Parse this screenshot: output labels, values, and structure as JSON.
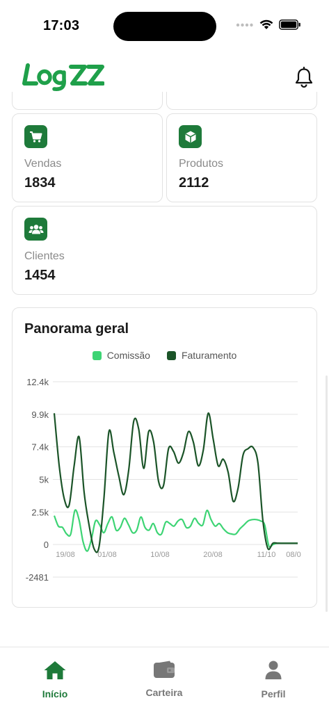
{
  "status_bar": {
    "time": "17:03"
  },
  "header": {
    "brand": "LOGZZ"
  },
  "stats": [
    {
      "label": "Vendas",
      "value": "1834",
      "icon": "cart-icon"
    },
    {
      "label": "Produtos",
      "value": "2112",
      "icon": "box-icon"
    },
    {
      "label": "Clientes",
      "value": "1454",
      "icon": "users-icon"
    }
  ],
  "chart": {
    "title": "Panorama geral"
  },
  "chart_data": {
    "type": "line",
    "yticks": [
      "12.4k",
      "9.9k",
      "7.4k",
      "5k",
      "2.5k",
      "0",
      "-2481"
    ],
    "ylim": [
      -2481,
      12400
    ],
    "xticks": [
      "19/08",
      "01/08",
      "10/08",
      "20/08",
      "11/10",
      "08/0"
    ],
    "x": [
      0,
      4,
      9,
      13,
      18,
      22,
      27,
      31,
      36,
      40,
      45,
      49,
      54,
      58,
      63,
      67,
      72,
      76,
      81,
      85,
      90,
      94,
      99,
      103,
      108,
      112,
      117,
      121,
      126,
      130,
      135,
      139,
      144,
      148,
      153,
      157,
      162,
      166,
      171,
      175,
      180,
      184,
      189,
      193,
      198,
      202,
      207,
      211,
      216,
      220,
      225,
      229,
      234,
      238,
      243,
      247,
      252,
      256,
      261,
      265,
      270,
      274,
      279,
      283,
      288,
      292,
      297,
      301,
      306,
      310,
      315,
      319,
      324,
      328,
      333,
      337,
      342,
      346,
      351
    ],
    "series": [
      {
        "name": "Comissão",
        "color": "#3dd474",
        "values": [
          2200,
          1400,
          1300,
          800,
          800,
          2600,
          1900,
          200,
          -500,
          400,
          1800,
          1500,
          900,
          1600,
          2100,
          1100,
          1300,
          2000,
          1500,
          900,
          1100,
          2100,
          1300,
          1100,
          1600,
          900,
          800,
          1700,
          1600,
          1400,
          1800,
          1900,
          1300,
          1400,
          2000,
          1600,
          1500,
          2600,
          1900,
          1400,
          1600,
          1200,
          900,
          800,
          800,
          1200,
          1500,
          1800,
          1900,
          1900,
          1800,
          1500,
          -100,
          0,
          100,
          100,
          100,
          100,
          100,
          100
        ]
      },
      {
        "name": "Faturamento",
        "color": "#1b5428",
        "values": [
          10000,
          6000,
          3500,
          3000,
          6000,
          8200,
          4000,
          1500,
          -300,
          -200,
          3500,
          8600,
          7000,
          5200,
          3800,
          5700,
          9400,
          8800,
          5800,
          8600,
          7800,
          4800,
          4500,
          7300,
          7100,
          6200,
          7000,
          8600,
          7800,
          6000,
          7200,
          10000,
          8000,
          6000,
          6500,
          5500,
          3300,
          4300,
          6800,
          7300,
          7400,
          6200,
          1800,
          -300,
          100,
          100,
          100,
          100,
          100,
          100
        ]
      }
    ]
  },
  "tabs": [
    {
      "label": "Início",
      "icon": "home-icon",
      "active": true
    },
    {
      "label": "Carteira",
      "icon": "wallet-icon",
      "active": false
    },
    {
      "label": "Perfil",
      "icon": "person-icon",
      "active": false
    }
  ],
  "colors": {
    "brand": "#1fa04a",
    "icon_bg": "#1e7a3a",
    "active_tab": "#1e7a3a",
    "inactive_tab": "#777777"
  }
}
